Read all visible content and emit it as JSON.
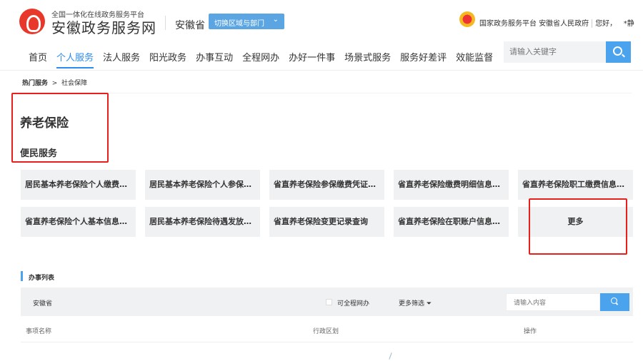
{
  "header": {
    "subtitle": "全国一体化在线政务服务平台",
    "title": "安徽政务服务网",
    "province": "安徽省",
    "switch_label": "切换区域与部门",
    "links": [
      "国家政务服务平台",
      "安徽省人民政府"
    ],
    "greeting": "您好，",
    "user": "*静"
  },
  "nav": {
    "items": [
      "首页",
      "个人服务",
      "法人服务",
      "阳光政务",
      "办事互动",
      "全程网办",
      "办好一件事",
      "场景式服务",
      "服务好差评",
      "效能监督"
    ],
    "active": "个人服务",
    "search_placeholder": "请输入关键字"
  },
  "breadcrumb": {
    "items": [
      "热门服务",
      "社会保障"
    ],
    "separator": ">"
  },
  "page": {
    "title": "养老保险",
    "subtitle": "便民服务"
  },
  "services": [
    "居民基本养老保险个人缴费信息查询",
    "居民基本养老保险个人参保信息查询",
    "省直养老保险参保缴费凭证打印",
    "省直养老保险缴费明细信息查询",
    "省直养老保险职工缴费信息查询",
    "省直养老保险个人基本信息查询",
    "居民基本养老保险待遇发放信息查询",
    "省直养老保险变更记录查询",
    "省直养老保险在职账户信息查询"
  ],
  "more_label": "更多",
  "list": {
    "title": "办事列表",
    "province": "安徽省",
    "checkbox_label": "可全程网办",
    "more_filter": "更多筛选",
    "search_placeholder": "请输入内容",
    "columns": [
      "事项名称",
      "行政区划",
      "操作"
    ]
  },
  "colors": {
    "accent": "#4aa3ec",
    "highlight": "#e8201c"
  }
}
